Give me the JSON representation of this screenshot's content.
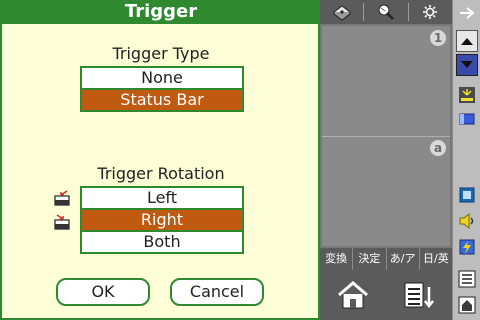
{
  "dialog": {
    "title": "Trigger",
    "trigger_type": {
      "title": "Trigger Type",
      "options": [
        {
          "label": "None",
          "selected": false
        },
        {
          "label": "Status Bar",
          "selected": true
        }
      ]
    },
    "trigger_rotation": {
      "title": "Trigger Rotation",
      "options": [
        {
          "label": "Left",
          "selected": false
        },
        {
          "label": "Right",
          "selected": true
        },
        {
          "label": "Both",
          "selected": false
        }
      ]
    },
    "ok_label": "OK",
    "cancel_label": "Cancel"
  },
  "ime": {
    "area_badges": [
      "1",
      "a"
    ],
    "keys": [
      "変換",
      "決定",
      "あ/ア",
      "日/英"
    ]
  },
  "colors": {
    "accent_green": "#2f8a2f",
    "selected_orange": "#c05a10",
    "dialog_bg": "#fefed7"
  }
}
